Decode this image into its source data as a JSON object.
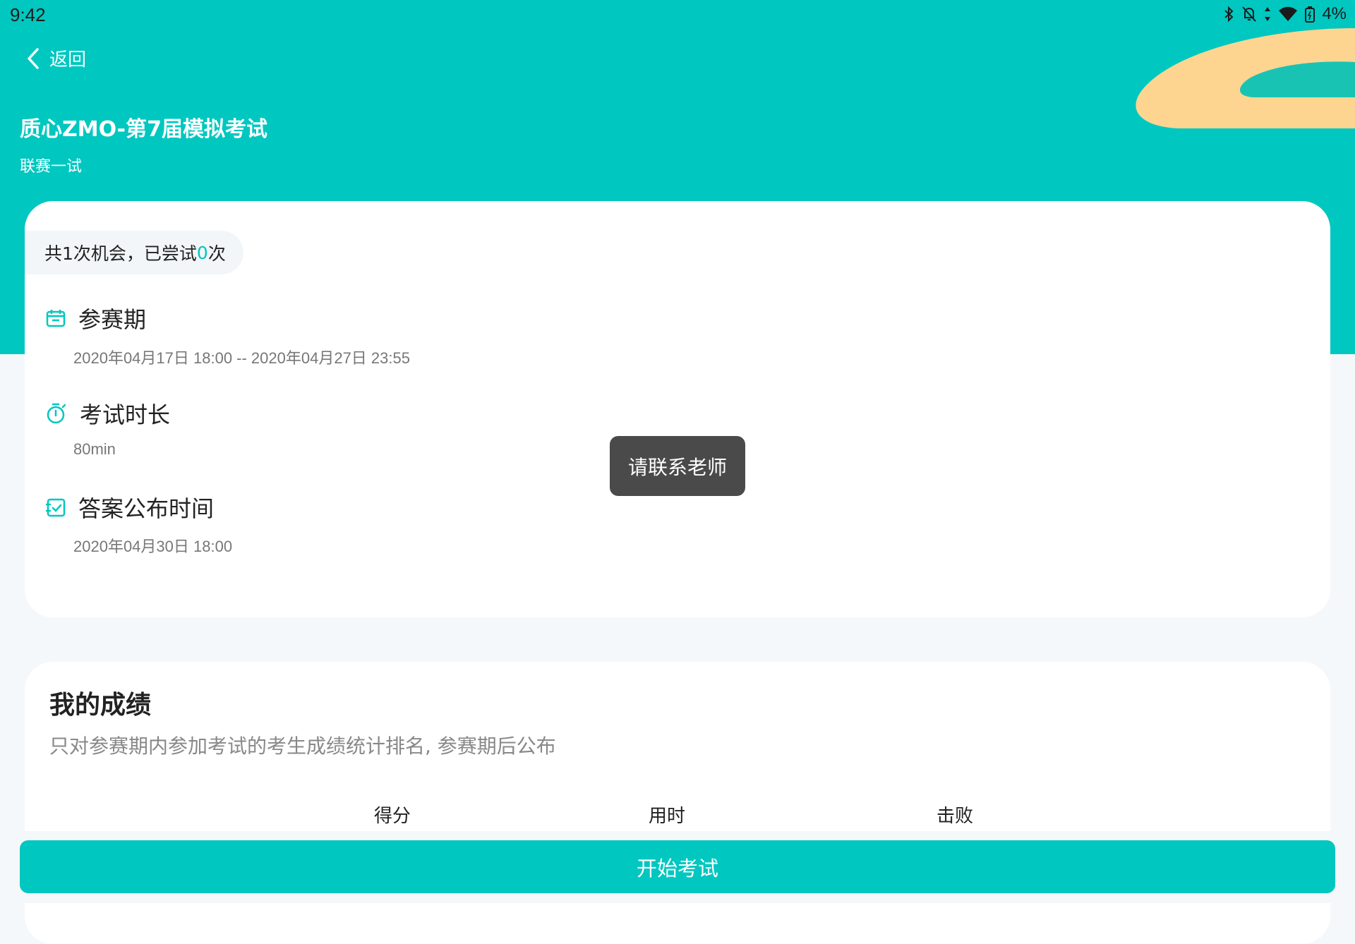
{
  "status_bar": {
    "time": "9:42",
    "battery": "4%"
  },
  "header": {
    "back_label": "返回",
    "title": "质心ZMO-第7届模拟考试",
    "subtitle": "联赛一试"
  },
  "attempts": {
    "prefix": "共1次机会，已尝试",
    "count": "0",
    "suffix": "次"
  },
  "info": {
    "period_label": "参赛期",
    "period_value": "2020年04月17日 18:00  --  2020年04月27日 23:55",
    "duration_label": "考试时长",
    "duration_value": "80min",
    "answer_label": "答案公布时间",
    "answer_value": "2020年04月30日 18:00"
  },
  "toast": "请联系老师",
  "score": {
    "title": "我的成绩",
    "description": "只对参赛期内参加考试的考生成绩统计排名, 参赛期后公布",
    "columns": [
      "得分",
      "用时",
      "击败"
    ]
  },
  "start_button": "开始考试",
  "colors": {
    "accent": "#00c7c0",
    "deco_orange": "#fdd591",
    "toast_bg": "#4a4a4a"
  }
}
